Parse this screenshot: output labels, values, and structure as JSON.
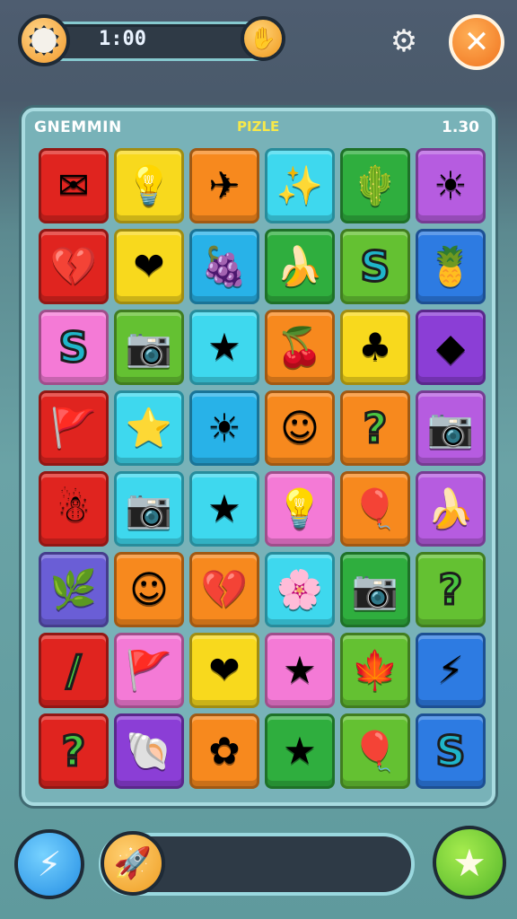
{
  "header": {
    "timer": "1:00",
    "icons": {
      "left": "cog-badge-icon",
      "hand": "hand-icon",
      "settings": "gear-icon",
      "close": "close-icon"
    }
  },
  "board": {
    "left_label": "GNEMMIN",
    "mid_label": "PIZLE",
    "right_label": "1.30"
  },
  "tiles": [
    {
      "icon": "✉",
      "name": "mail-icon",
      "color": "red"
    },
    {
      "icon": "💡",
      "name": "bulb-icon",
      "color": "yellow"
    },
    {
      "icon": "✈",
      "name": "plane-icon",
      "color": "orange"
    },
    {
      "icon": "✨",
      "name": "sparkle-icon",
      "color": "cyan"
    },
    {
      "icon": "🌵",
      "name": "cactus-icon",
      "color": "green"
    },
    {
      "icon": "☀",
      "name": "sun-icon",
      "color": "violet"
    },
    {
      "icon": "💔",
      "name": "broken-heart-icon",
      "color": "red"
    },
    {
      "icon": "❤",
      "name": "heart-icon",
      "color": "yellow"
    },
    {
      "icon": "🍇",
      "name": "grapes-icon",
      "color": "sky"
    },
    {
      "icon": "🍌",
      "name": "banana-icon",
      "color": "green"
    },
    {
      "icon": "S",
      "name": "s-letter-icon",
      "color": "lime"
    },
    {
      "icon": "🍍",
      "name": "pineapple-icon",
      "color": "blue"
    },
    {
      "icon": "S",
      "name": "s-letter-icon",
      "color": "pink"
    },
    {
      "icon": "📷",
      "name": "camera-icon",
      "color": "lime"
    },
    {
      "icon": "★",
      "name": "sparkle-star-icon",
      "color": "cyan"
    },
    {
      "icon": "🍒",
      "name": "cherry-icon",
      "color": "orange"
    },
    {
      "icon": "♣",
      "name": "leaf-icon",
      "color": "yellow"
    },
    {
      "icon": "◆",
      "name": "gem-icon",
      "color": "purple"
    },
    {
      "icon": "🚩",
      "name": "flag-icon",
      "color": "red"
    },
    {
      "icon": "⭐",
      "name": "star-icon",
      "color": "cyan"
    },
    {
      "icon": "☀",
      "name": "sun-icon",
      "color": "sky"
    },
    {
      "icon": "☺",
      "name": "smiley-icon",
      "color": "orange"
    },
    {
      "icon": "?",
      "name": "question-icon",
      "color": "orange"
    },
    {
      "icon": "📷",
      "name": "camera-icon",
      "color": "violet"
    },
    {
      "icon": "☃",
      "name": "ghost-icon",
      "color": "red"
    },
    {
      "icon": "📷",
      "name": "camera-icon",
      "color": "cyan"
    },
    {
      "icon": "★",
      "name": "sparkle-star-icon",
      "color": "cyan"
    },
    {
      "icon": "💡",
      "name": "bulb-icon",
      "color": "pink"
    },
    {
      "icon": "🎈",
      "name": "balloon-icon",
      "color": "orange"
    },
    {
      "icon": "🍌",
      "name": "banana-icon",
      "color": "violet"
    },
    {
      "icon": "🌿",
      "name": "plant-icon",
      "color": "indigo"
    },
    {
      "icon": "☺",
      "name": "face-icon",
      "color": "orange"
    },
    {
      "icon": "💔",
      "name": "broken-heart-icon",
      "color": "orange"
    },
    {
      "icon": "🌸",
      "name": "flower-icon",
      "color": "cyan"
    },
    {
      "icon": "📷",
      "name": "camera-icon",
      "color": "green"
    },
    {
      "icon": "?",
      "name": "question-icon",
      "color": "lime"
    },
    {
      "icon": "/",
      "name": "stick-icon",
      "color": "red"
    },
    {
      "icon": "🚩",
      "name": "flag-icon",
      "color": "pink"
    },
    {
      "icon": "❤",
      "name": "heart-icon",
      "color": "yellow"
    },
    {
      "icon": "★",
      "name": "star-icon",
      "color": "pink"
    },
    {
      "icon": "🍁",
      "name": "leaf-icon",
      "color": "lime"
    },
    {
      "icon": "⚡",
      "name": "bolt-icon",
      "color": "blue"
    },
    {
      "icon": "?",
      "name": "question-icon",
      "color": "red"
    },
    {
      "icon": "🐚",
      "name": "shell-icon",
      "color": "purple"
    },
    {
      "icon": "✿",
      "name": "flower-icon",
      "color": "orange"
    },
    {
      "icon": "★",
      "name": "star-icon",
      "color": "green"
    },
    {
      "icon": "🎈",
      "name": "balloon-icon",
      "color": "lime"
    },
    {
      "icon": "S",
      "name": "s-letter-icon",
      "color": "blue"
    }
  ],
  "footer": {
    "left_button": "bolt-icon",
    "progress_button": "rocket-icon",
    "progress_fraction": 0.15,
    "right_button": "star-icon"
  },
  "colors": {
    "red": "#e0241f",
    "yellow": "#f8d91d",
    "orange": "#f7891e",
    "cyan": "#3ed8ee",
    "green": "#2fae3e",
    "lime": "#64c132",
    "violet": "#b65ce0",
    "purple": "#8b3ed6",
    "pink": "#f47ad6",
    "blue": "#2d7be2",
    "indigo": "#6a5ed6",
    "sky": "#28b2e8"
  }
}
